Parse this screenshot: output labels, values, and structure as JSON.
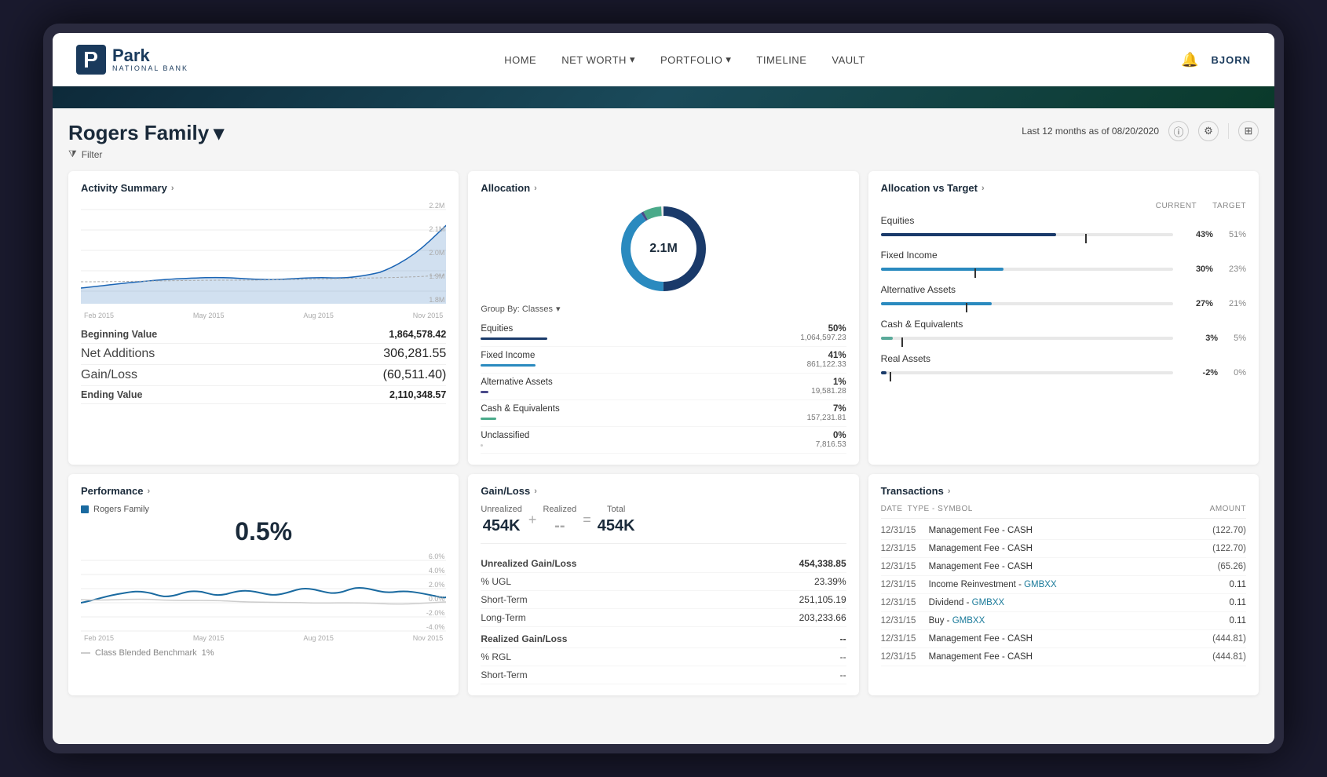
{
  "navbar": {
    "logo_letter": "P",
    "logo_park": "Park",
    "logo_national": "NATIONAL BANK",
    "nav_links": [
      {
        "label": "HOME",
        "active": false
      },
      {
        "label": "NET WORTH",
        "dropdown": true,
        "active": false
      },
      {
        "label": "PORTFOLIO",
        "dropdown": true,
        "active": false
      },
      {
        "label": "TIMELINE",
        "active": false
      },
      {
        "label": "VAULT",
        "active": false
      }
    ],
    "user_name": "BJORN"
  },
  "page_header": {
    "family_title": "Rogers Family",
    "filter_label": "Filter",
    "date_info": "Last 12 months as of 08/20/2020"
  },
  "activity_summary": {
    "title": "Activity Summary",
    "chart_y_labels": [
      "2.2M",
      "2.1M",
      "2.0M",
      "1.9M",
      "1.8M"
    ],
    "chart_x_labels": [
      "Feb 2015",
      "May 2015",
      "Aug 2015",
      "Nov 2015"
    ],
    "stats": [
      {
        "label": "Beginning Value",
        "value": "1,864,578.42",
        "bold": true
      },
      {
        "label": "Net Additions",
        "value": "306,281.55",
        "bold": false
      },
      {
        "label": "Gain/Loss",
        "value": "(60,511.40)",
        "bold": false
      },
      {
        "label": "Ending Value",
        "value": "2,110,348.57",
        "bold": true
      }
    ]
  },
  "allocation": {
    "title": "Allocation",
    "donut_center": "2.1M",
    "group_by_label": "Group By: Classes",
    "rows": [
      {
        "label": "Equities",
        "pct": "50%",
        "amount": "1,064,597.23",
        "color": "#1a3a6a",
        "width": "85"
      },
      {
        "label": "Fixed Income",
        "pct": "41%",
        "amount": "861,122.33",
        "color": "#2a8abf",
        "width": "70"
      },
      {
        "label": "Alternative Assets",
        "pct": "1%",
        "amount": "19,581.28",
        "color": "#4a4a8a",
        "width": "10"
      },
      {
        "label": "Cash & Equivalents",
        "pct": "7%",
        "amount": "157,231.81",
        "color": "#5aaa9a",
        "width": "20"
      },
      {
        "label": "Unclassified",
        "pct": "0%",
        "amount": "7,816.53",
        "color": "#cccccc",
        "width": "3"
      }
    ]
  },
  "allocation_vs_target": {
    "title": "Allocation vs Target",
    "col_current": "CURRENT",
    "col_target": "TARGET",
    "rows": [
      {
        "label": "Equities",
        "current": "43%",
        "target": "51%",
        "fill_w": 60,
        "marker": 70,
        "color": "#1a3a6a"
      },
      {
        "label": "Fixed Income",
        "current": "30%",
        "target": "23%",
        "fill_w": 42,
        "marker": 32,
        "color": "#2a8abf"
      },
      {
        "label": "Alternative Assets",
        "current": "27%",
        "target": "21%",
        "fill_w": 38,
        "marker": 29,
        "color": "#2a8abf"
      },
      {
        "label": "Cash & Equivalents",
        "current": "3%",
        "target": "5%",
        "fill_w": 4,
        "marker": 7,
        "color": "#5aaa9a"
      },
      {
        "label": "Real Assets",
        "current": "-2%",
        "target": "0%",
        "fill_w": 2,
        "marker": 3,
        "color": "#1a3a6a"
      }
    ]
  },
  "performance": {
    "title": "Performance",
    "legend_label": "Rogers Family",
    "value": "0.5%",
    "chart_x_labels": [
      "Feb 2015",
      "May 2015",
      "Aug 2015",
      "Nov 2015"
    ],
    "chart_y_labels": [
      "6.0%",
      "4.0%",
      "2.0%",
      "0.0%",
      "-2.0%",
      "-4.0%"
    ],
    "benchmark_label": "Class Blended Benchmark",
    "benchmark_value": "1%"
  },
  "gain_loss": {
    "title": "Gain/Loss",
    "unrealized_label": "Unrealized",
    "unrealized_value": "454K",
    "realized_label": "Realized",
    "realized_value": "--",
    "total_label": "Total",
    "total_value": "454K",
    "rows": [
      {
        "label": "Unrealized Gain/Loss",
        "value": "454,338.85",
        "bold": true
      },
      {
        "label": "% UGL",
        "value": "23.39%",
        "bold": false
      },
      {
        "label": "Short-Term",
        "value": "251,105.19",
        "bold": false
      },
      {
        "label": "Long-Term",
        "value": "203,233.66",
        "bold": false
      },
      {
        "label": "Realized Gain/Loss",
        "value": "--",
        "bold": true
      },
      {
        "label": "% RGL",
        "value": "--",
        "bold": false
      },
      {
        "label": "Short-Term",
        "value": "--",
        "bold": false
      }
    ]
  },
  "transactions": {
    "title": "Transactions",
    "col_date": "Date",
    "col_type": "Type - Symbol",
    "col_amount": "Amount",
    "rows": [
      {
        "date": "12/31/15",
        "type": "Management Fee - CASH",
        "link": null,
        "amount": "(122.70)"
      },
      {
        "date": "12/31/15",
        "type": "Management Fee - CASH",
        "link": null,
        "amount": "(122.70)"
      },
      {
        "date": "12/31/15",
        "type": "Management Fee - CASH",
        "link": null,
        "amount": "(65.26)"
      },
      {
        "date": "12/31/15",
        "type": "Income Reinvestment - ",
        "link": "GMBXX",
        "amount": "0.11"
      },
      {
        "date": "12/31/15",
        "type": "Dividend - ",
        "link": "GMBXX",
        "amount": "0.11"
      },
      {
        "date": "12/31/15",
        "type": "Buy - ",
        "link": "GMBXX",
        "amount": "0.11"
      },
      {
        "date": "12/31/15",
        "type": "Management Fee - CASH",
        "link": null,
        "amount": "(444.81)"
      },
      {
        "date": "12/31/15",
        "type": "Management Fee - CASH",
        "link": null,
        "amount": "(444.81)"
      }
    ]
  }
}
